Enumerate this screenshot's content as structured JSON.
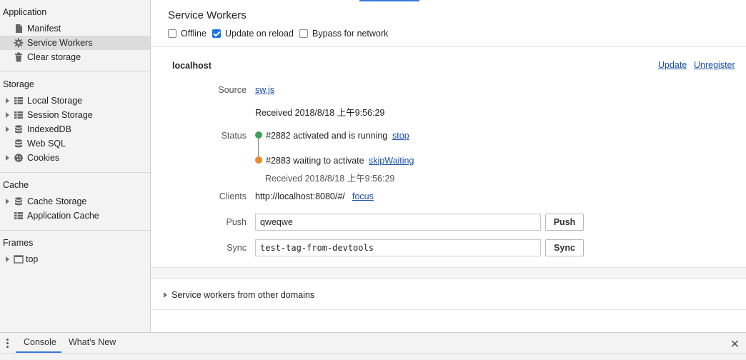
{
  "sidebar": {
    "application": {
      "title": "Application",
      "items": [
        {
          "label": "Manifest",
          "icon": "document-icon"
        },
        {
          "label": "Service Workers",
          "icon": "gear-icon"
        },
        {
          "label": "Clear storage",
          "icon": "trash-icon"
        }
      ]
    },
    "storage": {
      "title": "Storage",
      "items": [
        {
          "label": "Local Storage",
          "icon": "grid-icon"
        },
        {
          "label": "Session Storage",
          "icon": "grid-icon"
        },
        {
          "label": "IndexedDB",
          "icon": "database-icon"
        },
        {
          "label": "Web SQL",
          "icon": "database-icon"
        },
        {
          "label": "Cookies",
          "icon": "cookie-icon"
        }
      ]
    },
    "cache": {
      "title": "Cache",
      "items": [
        {
          "label": "Cache Storage",
          "icon": "database-icon"
        },
        {
          "label": "Application Cache",
          "icon": "grid-icon"
        }
      ]
    },
    "frames": {
      "title": "Frames",
      "items": [
        {
          "label": "top",
          "icon": "frame-icon"
        }
      ]
    }
  },
  "main": {
    "title": "Service Workers",
    "options": {
      "offline": {
        "label": "Offline",
        "checked": false
      },
      "update_on_reload": {
        "label": "Update on reload",
        "checked": true
      },
      "bypass": {
        "label": "Bypass for network",
        "checked": false
      }
    },
    "worker": {
      "origin": "localhost",
      "update_label": "Update",
      "unregister_label": "Unregister",
      "source_label": "Source",
      "source_link": "sw.js",
      "received": "Received 2018/8/18 上午9:56:29",
      "status_label": "Status",
      "active_status": "#2882 activated and is running",
      "stop_label": "stop",
      "waiting_status": "#2883 waiting to activate",
      "skip_waiting_label": "skipWaiting",
      "waiting_received": "Received 2018/8/18 上午9:56:29",
      "clients_label": "Clients",
      "client_url": "http://localhost:8080/#/",
      "focus_label": "focus",
      "push_label": "Push",
      "push_value": "qweqwe",
      "push_button": "Push",
      "sync_label": "Sync",
      "sync_value": "test-tag-from-devtools",
      "sync_button": "Sync"
    },
    "other_domains": "Service workers from other domains"
  },
  "drawer": {
    "tabs": [
      "Console",
      "What's New"
    ]
  },
  "colors": {
    "link": "#1a4ea8",
    "accent": "#3879d9",
    "running": "#3ea15b",
    "waiting": "#e8872e"
  }
}
